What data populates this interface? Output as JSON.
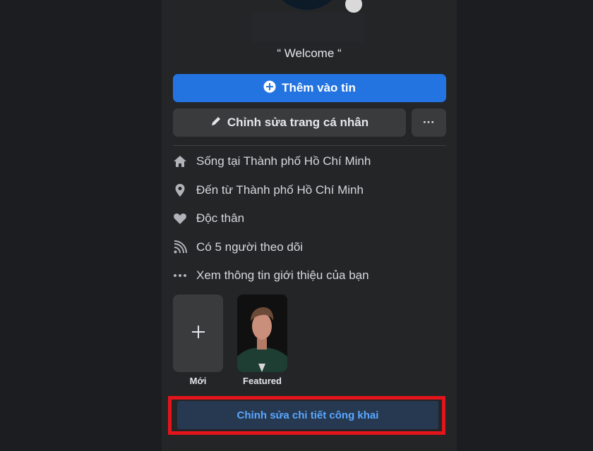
{
  "profile": {
    "bio": "“ Welcome “"
  },
  "actions": {
    "add_story_label": "Thêm vào tin",
    "edit_profile_label": "Chỉnh sửa trang cá nhân",
    "more_label": "···"
  },
  "intro": {
    "items": [
      {
        "icon": "home-icon",
        "text": "Sống tại Thành phố Hồ Chí Minh"
      },
      {
        "icon": "location-pin-icon",
        "text": "Đến từ Thành phố Hồ Chí Minh"
      },
      {
        "icon": "heart-icon",
        "text": "Độc thân"
      },
      {
        "icon": "rss-icon",
        "text": "Có 5 người theo dõi"
      },
      {
        "icon": "more-dots-icon",
        "text": "Xem thông tin giới thiệu của bạn"
      }
    ]
  },
  "featured": {
    "new_label": "Mới",
    "featured_label": "Featured"
  },
  "footer": {
    "edit_public_label": "Chỉnh sửa chi tiết công khai"
  },
  "colors": {
    "background": "#1c1d20",
    "panel": "#242527",
    "primary": "#2374e1",
    "highlight_border": "#e3141b",
    "link_blue": "#5aa7ff"
  }
}
